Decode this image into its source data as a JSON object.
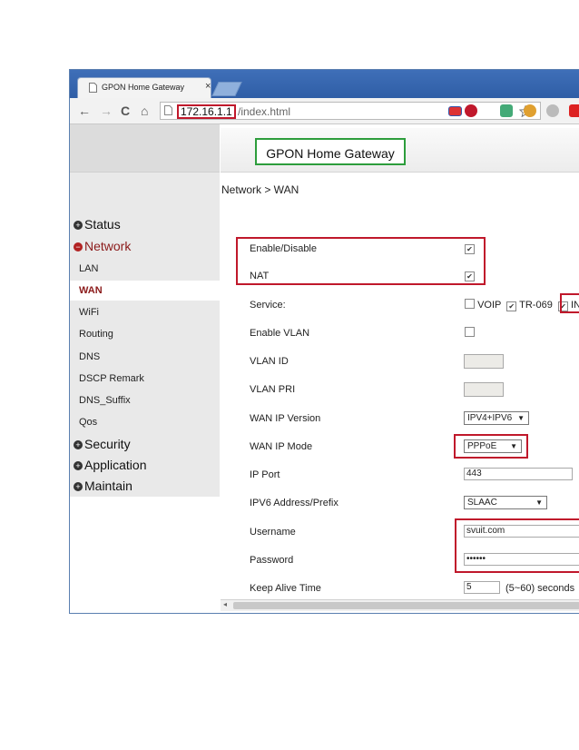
{
  "tab": {
    "title": "GPON Home Gateway",
    "close": "×"
  },
  "toolbar": {
    "back": "←",
    "forward": "→",
    "reload": "C",
    "home": "⌂"
  },
  "url": {
    "host": "172.16.1.1",
    "path": "/index.html"
  },
  "header": {
    "title": "GPON Home Gateway"
  },
  "breadcrumb": "Network > WAN",
  "sidebar": {
    "groups": {
      "status": "Status",
      "network": "Network",
      "security": "Security",
      "application": "Application",
      "maintain": "Maintain"
    },
    "network_items": [
      "LAN",
      "WAN",
      "WiFi",
      "Routing",
      "DNS",
      "DSCP Remark",
      "DNS_Suffix",
      "Qos"
    ]
  },
  "form": {
    "enable_label": "Enable/Disable",
    "nat_label": "NAT",
    "service_label": "Service:",
    "service_voip": "VOIP",
    "service_tr069": "TR-069",
    "service_internet": "IN",
    "enable_vlan_label": "Enable VLAN",
    "vlan_id_label": "VLAN ID",
    "vlan_pri_label": "VLAN PRI",
    "ip_version_label": "WAN IP Version",
    "ip_version_value": "IPV4+IPV6",
    "ip_mode_label": "WAN IP Mode",
    "ip_mode_value": "PPPoE",
    "ip_port_label": "IP Port",
    "ip_port_value": "443",
    "ipv6_label": "IPV6 Address/Prefix",
    "ipv6_value": "SLAAC",
    "username_label": "Username",
    "username_value": "svuit.com",
    "password_label": "Password",
    "password_value": "••••••",
    "keepalive_label": "Keep Alive Time",
    "keepalive_value": "5",
    "keepalive_unit": "(5~60) seconds"
  },
  "colors": {
    "highlight_red": "#c0182b",
    "highlight_green": "#2d9d3c",
    "active_nav": "#8b1a1a"
  }
}
